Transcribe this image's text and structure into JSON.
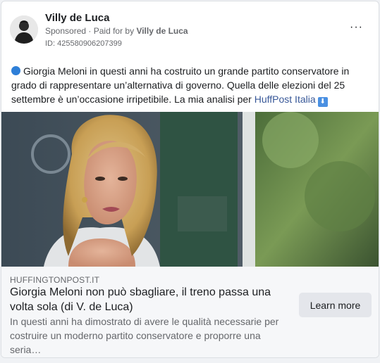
{
  "post": {
    "author": "Villy de Luca",
    "sponsored": "Sponsored",
    "paid_for_prefix": "· Paid for by",
    "paid_for_by": "Villy de Luca",
    "ad_id": "ID: 425580906207399",
    "more_label": "···",
    "text_main": "Giorgia Meloni in questi anni ha costruito un grande partito conservatore in grado di rappresentare un’alternativa di governo. Quella delle elezioni del 25 settembre è un’occasione irripetibile. La mia analisi per ",
    "text_link": "HuffPost Italia",
    "arrow_emoji": "⬇"
  },
  "link_preview": {
    "domain": "HUFFINGTONPOST.IT",
    "headline": "Giorgia Meloni non può sbagliare, il treno passa una volta sola (di V. de Luca)",
    "description": "In questi anni ha dimostrato di avere le qualità necessarie per costruire un moderno partito conservatore e proporre una seria…",
    "button_label": "Learn more"
  }
}
